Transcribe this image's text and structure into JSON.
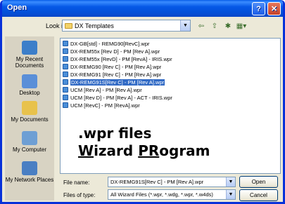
{
  "window": {
    "title": "Open",
    "help_glyph": "?",
    "close_glyph": "✕"
  },
  "lookin": {
    "label": "Look in:",
    "value": "DX Templates",
    "dropdown_glyph": "▼"
  },
  "toolbar": {
    "back": "⇦",
    "up": "⇧",
    "new_folder": "✱",
    "views": "▦▾"
  },
  "places": [
    {
      "label": "My Recent Documents",
      "icon": "recent-documents-icon",
      "color": "#3c7ec9"
    },
    {
      "label": "Desktop",
      "icon": "desktop-icon",
      "color": "#5a8fd8"
    },
    {
      "label": "My Documents",
      "icon": "my-documents-icon",
      "color": "#e8c24c"
    },
    {
      "label": "My Computer",
      "icon": "my-computer-icon",
      "color": "#6e9fd4"
    },
    {
      "label": "My Network Places",
      "icon": "network-places-icon",
      "color": "#4a7fc3"
    }
  ],
  "files": [
    "DX-GB[std] - REMG90[RevC].wpr",
    "DX-REM55x [Rev D] - PM [Rev A].wpr",
    "DX-REM55x [RevD] - PM [RevA] - IRIS.wpr",
    "DX-REMG90 [Rev C] - PM [Rev A].wpr",
    "DX-REMG91 [Rev C] - PM [Rev A].wpr",
    "DX-REMG91S[Rev C] - PM [Rev A].wpr",
    "UCM [Rev A] - PM [Rev A].wpr",
    "UCM [Rev D] - PM [Rev A] - ACT - IRIS.wpr",
    "UCM [RevC] - PM [RevA].wpr"
  ],
  "selected_index": 5,
  "annotation": {
    "line1": ".wpr files",
    "line2_w": "W",
    "line2_izard": "izard ",
    "line2_pr": "PR",
    "line2_ogram": "ogram"
  },
  "filename": {
    "label": "File name:",
    "value": "DX-REMG91S[Rev C] - PM [Rev A].wpr"
  },
  "filetype": {
    "label": "Files of type:",
    "value": "All Wizard Files (*.wpr, *.wdg, *.wpr, *.w4ds)"
  },
  "buttons": {
    "open": "Open",
    "cancel": "Cancel"
  },
  "colors": {
    "title_bar": "#0558e6",
    "selection": "#316ac5",
    "window_bg": "#ece9d8"
  }
}
